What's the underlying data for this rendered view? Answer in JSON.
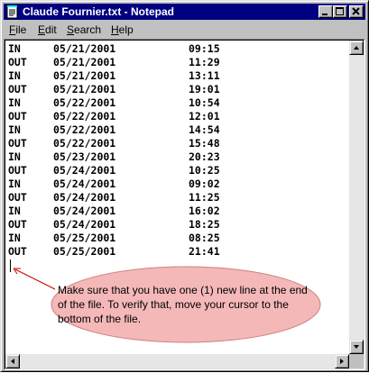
{
  "window": {
    "title": "Claude Fournier.txt - Notepad"
  },
  "menu": {
    "items": [
      {
        "label": "File",
        "accel": "F",
        "rest": "ile"
      },
      {
        "label": "Edit",
        "accel": "E",
        "rest": "dit"
      },
      {
        "label": "Search",
        "accel": "S",
        "rest": "earch"
      },
      {
        "label": "Help",
        "accel": "H",
        "rest": "elp"
      }
    ]
  },
  "document": {
    "lines": [
      {
        "dir": "IN",
        "date": "05/21/2001",
        "time": "09:15"
      },
      {
        "dir": "OUT",
        "date": "05/21/2001",
        "time": "11:29"
      },
      {
        "dir": "IN",
        "date": "05/21/2001",
        "time": "13:11"
      },
      {
        "dir": "OUT",
        "date": "05/21/2001",
        "time": "19:01"
      },
      {
        "dir": "IN",
        "date": "05/22/2001",
        "time": "10:54"
      },
      {
        "dir": "OUT",
        "date": "05/22/2001",
        "time": "12:01"
      },
      {
        "dir": "IN",
        "date": "05/22/2001",
        "time": "14:54"
      },
      {
        "dir": "OUT",
        "date": "05/22/2001",
        "time": "15:48"
      },
      {
        "dir": "IN",
        "date": "05/23/2001",
        "time": "20:23"
      },
      {
        "dir": "OUT",
        "date": "05/24/2001",
        "time": "10:25"
      },
      {
        "dir": "IN",
        "date": "05/24/2001",
        "time": "09:02"
      },
      {
        "dir": "OUT",
        "date": "05/24/2001",
        "time": "11:25"
      },
      {
        "dir": "IN",
        "date": "05/24/2001",
        "time": "16:02"
      },
      {
        "dir": "OUT",
        "date": "05/24/2001",
        "time": "18:25"
      },
      {
        "dir": "IN",
        "date": "05/25/2001",
        "time": "08:25"
      },
      {
        "dir": "OUT",
        "date": "05/25/2001",
        "time": "21:41"
      }
    ]
  },
  "callout": {
    "text": "Make sure that you have one (1) new line at the end of the file. To verify that, move your cursor to the bottom of the file."
  },
  "colors": {
    "titlebar": "#000080",
    "callout_fill": "#f4b8b8",
    "arrow": "#cc0000"
  },
  "icons": {
    "title_icon": "notepad-icon",
    "minimize": "minimize-icon",
    "maximize": "maximize-icon",
    "close": "close-icon"
  }
}
